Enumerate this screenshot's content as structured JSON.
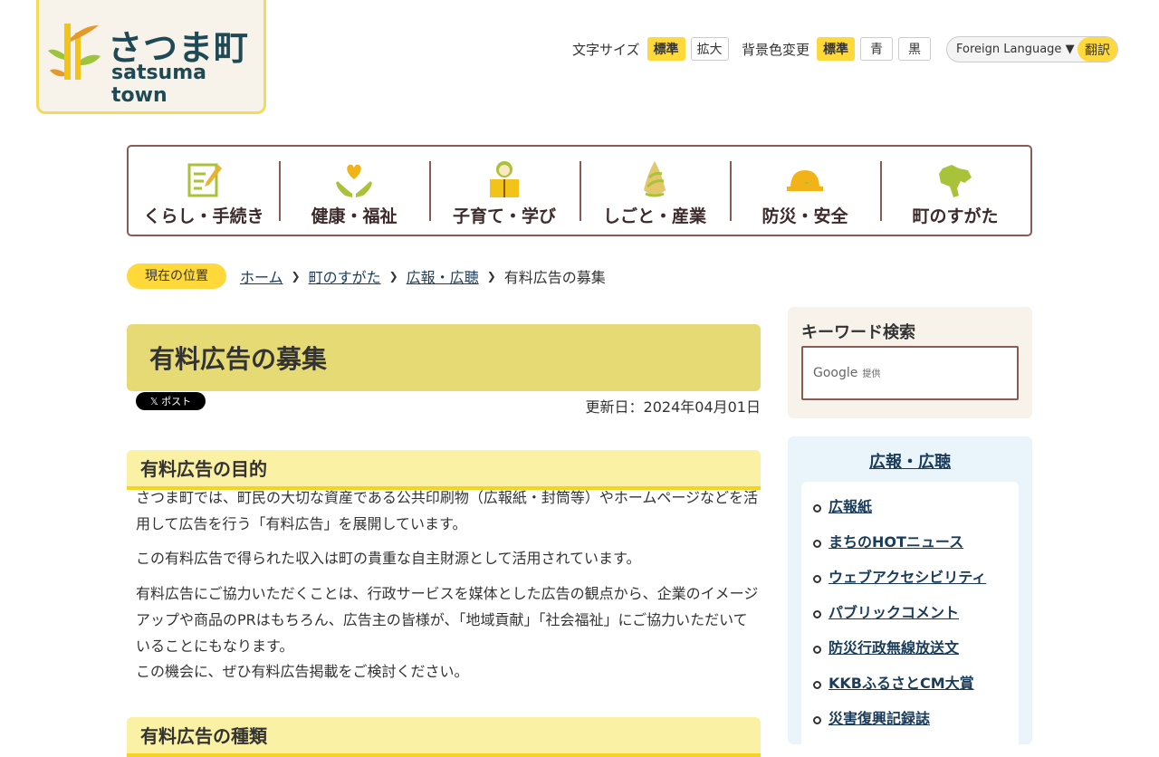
{
  "logo": {
    "jp": "さつま町",
    "en": "satsuma town"
  },
  "utility": {
    "font_size_label": "文字サイズ",
    "font_standard": "標準",
    "font_large": "拡大",
    "bg_label": "背景色変更",
    "bg_standard": "標準",
    "bg_blue": "青",
    "bg_black": "黒"
  },
  "language": {
    "select": "Foreign Language",
    "button": "翻訳"
  },
  "gnav": [
    {
      "label": "くらし・手続き",
      "icon": "form-icon"
    },
    {
      "label": "健康・福祉",
      "icon": "heart-hands-icon"
    },
    {
      "label": "子育て・学び",
      "icon": "child-book-icon"
    },
    {
      "label": "しごと・産業",
      "icon": "bamboo-shoot-icon"
    },
    {
      "label": "防災・安全",
      "icon": "helmet-icon"
    },
    {
      "label": "町のすがた",
      "icon": "town-map-icon"
    }
  ],
  "breadcrumb": {
    "here": "現在の位置",
    "items": [
      "ホーム",
      "町のすがた",
      "広報・広聴"
    ],
    "current": "有料広告の募集"
  },
  "page_title": "有料広告の募集",
  "share": {
    "x_post": "𝕏 ポスト"
  },
  "updated": "更新日：2024年04月01日",
  "sections": [
    {
      "heading": "有料広告の目的",
      "paragraphs": [
        "さつま町では、町民の大切な資産である公共印刷物（広報紙・封筒等）やホームページなどを活用して広告を行う「有料広告」を展開しています。",
        "この有料広告で得られた収入は町の貴重な自主財源として活用されています。",
        "有料広告にご協力いただくことは、行政サービスを媒体とした広告の観点から、企業のイメージアップや商品のPRはもちろん、広告主の皆様が、「地域貢献」「社会福祉」にご協力いただいていることにもなります。",
        "この機会に、ぜひ有料広告掲載をご検討ください。"
      ]
    },
    {
      "heading": "有料広告の種類"
    }
  ],
  "sidebar": {
    "search_title": "キーワード検索",
    "search_brand": "Google",
    "search_provided": "提供",
    "menu_title": "広報・広聴",
    "menu_items": [
      "広報紙",
      "まちのHOTニュース",
      "ウェブアクセシビリティ",
      "パブリックコメント",
      "防災行政無線放送文",
      "KKBふるさとCM大賞",
      "災害復興記録誌"
    ]
  },
  "colors": {
    "accent": "#ffd83a",
    "title_bg": "#e6da75",
    "heading_bg": "#fbf1a4",
    "nav_border": "#8a5a55",
    "side_menu_bg": "#e9f5fa"
  }
}
